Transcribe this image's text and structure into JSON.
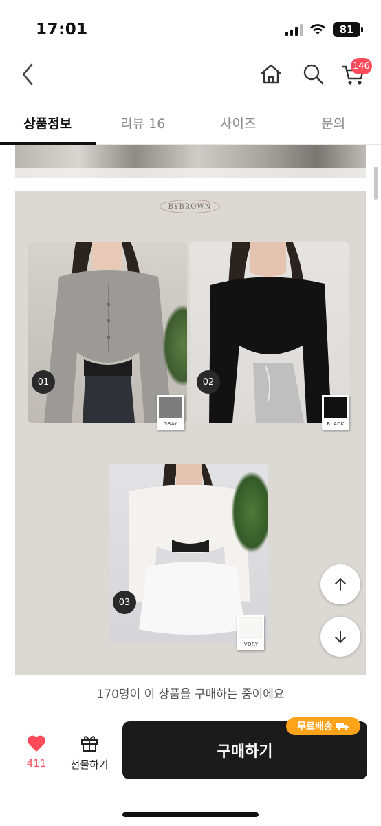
{
  "status_bar": {
    "time": "17:01",
    "battery": "81"
  },
  "nav": {
    "cart_count": "146"
  },
  "tabs": [
    {
      "label": "상품정보",
      "active": true
    },
    {
      "label": "리뷰 16",
      "active": false
    },
    {
      "label": "사이즈",
      "active": false
    },
    {
      "label": "문의",
      "active": false
    }
  ],
  "detail": {
    "brand": "BYBROWN",
    "variants": [
      {
        "number": "01",
        "color_name": "GRAY",
        "swatch": "#7d7d7d"
      },
      {
        "number": "02",
        "color_name": "BLACK",
        "swatch": "#111111"
      },
      {
        "number": "03",
        "color_name": "IVORY",
        "swatch": "#f7f7f5"
      }
    ]
  },
  "notice": {
    "text": "170명이 이 상품을 구매하는 중이에요"
  },
  "bottom": {
    "like_count": "411",
    "gift_label": "선물하기",
    "buy_label": "구매하기",
    "free_shipping": "무료배송"
  },
  "colors": {
    "accent": "#ff4a5a",
    "buy_button": "#1b1b1b",
    "badge_orange": "#ffa31a"
  }
}
